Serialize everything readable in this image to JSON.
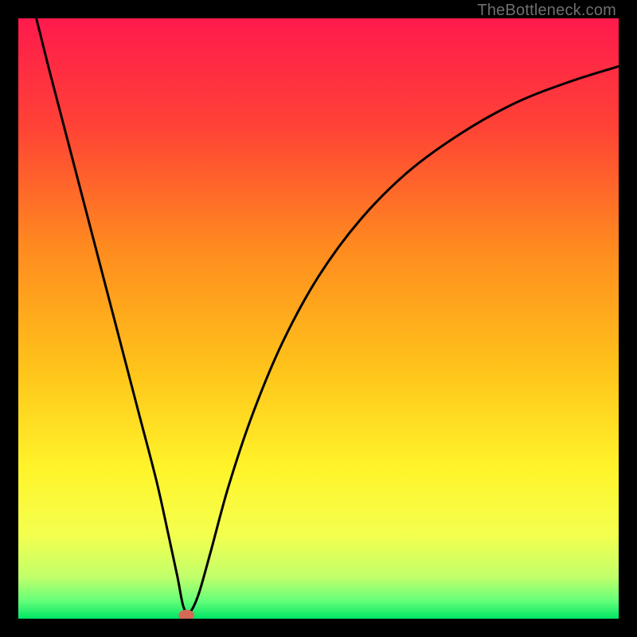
{
  "watermark": "TheBottleneck.com",
  "chart_data": {
    "type": "line",
    "title": "",
    "xlabel": "",
    "ylabel": "",
    "xlim": [
      0,
      100
    ],
    "ylim": [
      0,
      100
    ],
    "grid": false,
    "background_gradient": {
      "direction": "vertical",
      "stops": [
        {
          "pos": 0.0,
          "color": "#ff1a4d"
        },
        {
          "pos": 0.18,
          "color": "#ff4236"
        },
        {
          "pos": 0.38,
          "color": "#ff8a1f"
        },
        {
          "pos": 0.58,
          "color": "#ffc21a"
        },
        {
          "pos": 0.75,
          "color": "#fff42a"
        },
        {
          "pos": 0.86,
          "color": "#f4ff4e"
        },
        {
          "pos": 0.93,
          "color": "#c2ff6a"
        },
        {
          "pos": 0.97,
          "color": "#66ff7a"
        },
        {
          "pos": 1.0,
          "color": "#00e565"
        }
      ]
    },
    "series": [
      {
        "name": "bottleneck-curve",
        "color": "#000000",
        "x": [
          3,
          5,
          8,
          11,
          14,
          17,
          20,
          23,
          25,
          26.5,
          27.5,
          28.5,
          30,
          32,
          35,
          39,
          44,
          50,
          57,
          65,
          74,
          83,
          92,
          100
        ],
        "y": [
          100,
          92,
          80.5,
          69,
          57.5,
          46,
          34.5,
          23,
          14,
          7,
          2,
          1,
          4,
          11,
          22,
          34,
          46,
          57,
          66.5,
          74.5,
          81,
          86,
          89.5,
          92
        ]
      }
    ],
    "marker": {
      "name": "minimum-point",
      "x": 28,
      "y": 0.6,
      "rx": 1.3,
      "ry": 0.9,
      "color": "#d46a56"
    }
  }
}
